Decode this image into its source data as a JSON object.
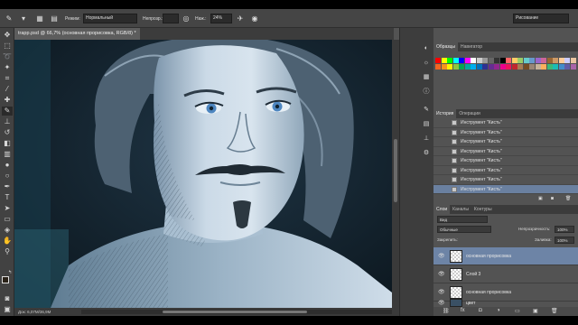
{
  "options": {
    "mode_label": "Режим:",
    "mode_value": "Нормальный",
    "opacity_label": "Непрозр.:",
    "flow_label": "Наж.:",
    "flow_value": "24%",
    "workspace_value": "Рисование"
  },
  "document": {
    "tab_title": "trapp.psd @ 66,7% (основная прорисовка, RGB/8) *",
    "status_text": "Док: 6,07M/36,9M"
  },
  "swatches_panel": {
    "tabs": [
      "Образцы",
      "Навигатор"
    ],
    "colors": [
      "#ff0000",
      "#ffff00",
      "#00ff00",
      "#00ffff",
      "#0000ff",
      "#ff00ff",
      "#ffffff",
      "#cccccc",
      "#999999",
      "#666666",
      "#333333",
      "#000000",
      "#ff6666",
      "#ffcc66",
      "#99cc66",
      "#66cccc",
      "#6699cc",
      "#9966cc",
      "#cc6699",
      "#996633",
      "#cc9966",
      "#ffcc99",
      "#ccccff",
      "#e8c4a0",
      "#f26522",
      "#f7941d",
      "#fff200",
      "#8dc63f",
      "#00a651",
      "#00a99d",
      "#00aeef",
      "#0072bc",
      "#2e3192",
      "#662d91",
      "#92278f",
      "#ec008c",
      "#ed145b",
      "#c1272d",
      "#a67c52",
      "#754c24",
      "#998675",
      "#c7b299",
      "#fbaf5d",
      "#3cb878",
      "#1cbbb4",
      "#448ccb",
      "#605ca8",
      "#a864a8"
    ]
  },
  "history_panel": {
    "tabs": [
      "История",
      "Операции"
    ],
    "items": [
      "Инструмент \"Кисть\"",
      "Инструмент \"Кисть\"",
      "Инструмент \"Кисть\"",
      "Инструмент \"Кисть\"",
      "Инструмент \"Кисть\"",
      "Инструмент \"Кисть\"",
      "Инструмент \"Кисть\"",
      "Инструмент \"Кисть\""
    ]
  },
  "layers_panel": {
    "tabs": [
      "Слои",
      "Каналы",
      "Контуры"
    ],
    "filter_value": "Вид",
    "blend_value": "Обычные",
    "opacity_label": "Непрозрачность:",
    "opacity_value": "100%",
    "lock_label": "Закрепить:",
    "fill_label": "Заливка:",
    "fill_value": "100%",
    "layers": [
      "основная прорисовка",
      "Слой 3",
      "основная прорисовка",
      "цвет"
    ]
  },
  "colors": {
    "accent": "#6d84a6"
  }
}
